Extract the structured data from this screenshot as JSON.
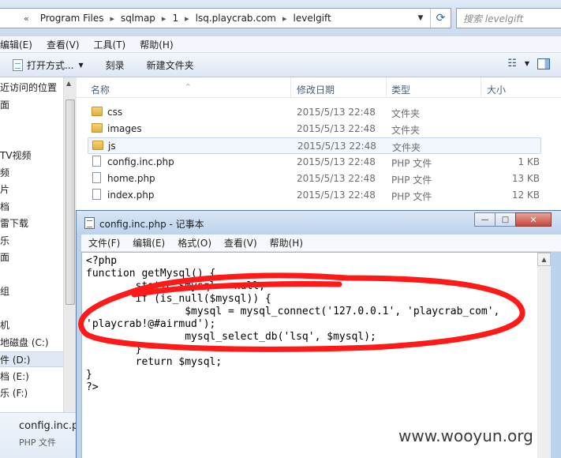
{
  "address_bar": {
    "overflow_glyph": "«",
    "crumbs": [
      "Program Files",
      "sqlmap",
      "1",
      "lsq.playcrab.com",
      "levelgift"
    ],
    "separator": "▸",
    "dropdown_glyph": "▼",
    "refresh_glyph": "⟳"
  },
  "search": {
    "placeholder": "搜索 levelgift"
  },
  "menubar": {
    "items": [
      "编辑(E)",
      "查看(V)",
      "工具(T)",
      "帮助(H)"
    ]
  },
  "toolbar": {
    "open_label": "打开方式...",
    "burn_label": "刻录",
    "new_folder_label": "新建文件夹",
    "caret_glyph": "▼",
    "view_glyph": "☷"
  },
  "nav_pane": {
    "items": [
      "近访问的位置",
      "面",
      "",
      "",
      "TV视频",
      "频",
      "片",
      "档",
      "雷下载",
      "乐",
      "面",
      "",
      "组",
      "",
      "机",
      "地磁盘 (C:)",
      "件 (D:)",
      "档 (E:)",
      "乐 (F:)"
    ]
  },
  "file_list": {
    "sort_glyph": "^",
    "headers": {
      "name": "名称",
      "modified": "修改日期",
      "type": "类型",
      "size": "大小"
    },
    "rows": [
      {
        "name": "css",
        "date": "2015/5/13 22:48",
        "type": "文件夹",
        "size": ""
      },
      {
        "name": "images",
        "date": "2015/5/13 22:48",
        "type": "文件夹",
        "size": ""
      },
      {
        "name": "js",
        "date": "2015/5/13 22:48",
        "type": "文件夹",
        "size": ""
      },
      {
        "name": "config.inc.php",
        "date": "2015/5/13 22:48",
        "type": "PHP 文件",
        "size": "1 KB"
      },
      {
        "name": "home.php",
        "date": "2015/5/13 22:48",
        "type": "PHP 文件",
        "size": "13 KB"
      },
      {
        "name": "index.php",
        "date": "2015/5/13 22:48",
        "type": "PHP 文件",
        "size": "12 KB"
      }
    ]
  },
  "details_pane": {
    "name": "config.inc.ph",
    "type": "PHP 文件"
  },
  "notepad": {
    "title": "config.inc.php - 记事本",
    "window_buttons": {
      "minimize": "—",
      "maximize": "□",
      "close": "✕"
    },
    "menu": [
      "文件(F)",
      "编辑(E)",
      "格式(O)",
      "查看(V)",
      "帮助(H)"
    ],
    "code_lines": [
      "<?php",
      "function getMysql() {",
      "        static $mysql = null;",
      "        if (is_null($mysql)) {",
      "                $mysql = mysql_connect('127.0.0.1', 'playcrab_com',",
      "'playcrab!@#airmud');",
      "                mysql_select_db('lsq', $mysql);",
      "        }",
      "        return $mysql;",
      "}",
      "?>"
    ],
    "scroll_up_glyph": "▲"
  },
  "annotation": {
    "color": "#ff1a1a"
  },
  "watermark": "www.wooyun.org"
}
